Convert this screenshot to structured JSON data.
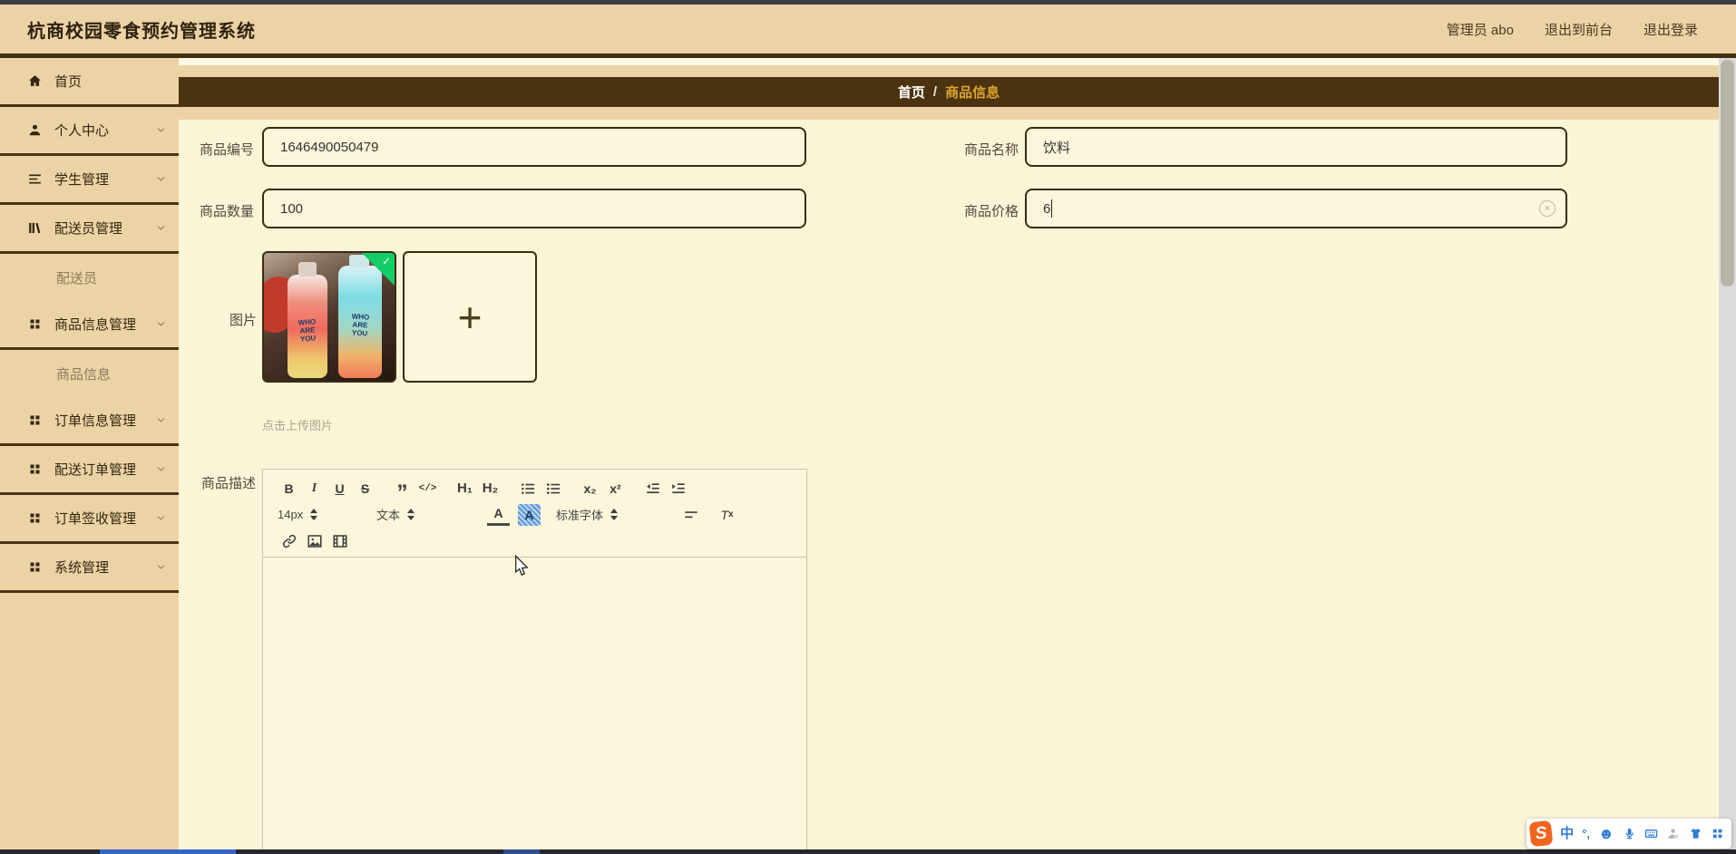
{
  "app": {
    "title": "杭商校园零食预约管理系统"
  },
  "header": {
    "user": "管理员 abo",
    "link_front": "退出到前台",
    "link_logout": "退出登录"
  },
  "sidebar": {
    "items": [
      {
        "label": "首页"
      },
      {
        "label": "个人中心"
      },
      {
        "label": "学生管理"
      },
      {
        "label": "配送员管理",
        "children": [
          "配送员"
        ]
      },
      {
        "label": "商品信息管理",
        "children": [
          "商品信息"
        ]
      },
      {
        "label": "订单信息管理"
      },
      {
        "label": "配送订单管理"
      },
      {
        "label": "订单签收管理"
      },
      {
        "label": "系统管理"
      }
    ]
  },
  "breadcrumb": {
    "home": "首页",
    "sep": "/",
    "current": "商品信息"
  },
  "form": {
    "fields": [
      {
        "label": "商品编号",
        "value": "1646490050479"
      },
      {
        "label": "商品名称",
        "value": "饮料"
      },
      {
        "label": "商品数量",
        "value": "100"
      },
      {
        "label": "商品价格",
        "value": "6"
      }
    ],
    "image_label": "图片",
    "upload_hint": "点击上传图片",
    "desc_label": "商品描述",
    "clear_glyph": "×",
    "plus_glyph": "+",
    "check_glyph": "✓"
  },
  "photo": {
    "line1": "WHO",
    "line2": "ARE",
    "line3": "YOU"
  },
  "editor": {
    "bold": "B",
    "italic": "I",
    "underline": "U",
    "strike": "S",
    "quote": "”",
    "code": "</>",
    "h1": "H₁",
    "h2": "H₂",
    "sub": "x₂",
    "sup": "x²",
    "size": "14px",
    "text": "文本",
    "font": "标准字体",
    "color_letter": "A",
    "highlight_letter": "A",
    "clean_t": "T",
    "clean_x": "x"
  },
  "ime": {
    "logo": "S",
    "lang": "中",
    "punct": "°,",
    "emoji": "☻"
  }
}
